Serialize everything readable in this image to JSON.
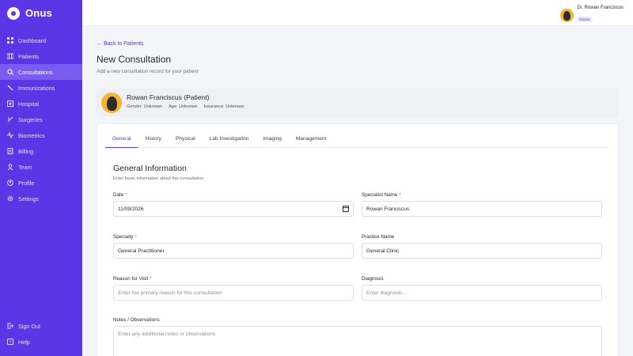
{
  "brand": {
    "name": "Onus"
  },
  "sidebar": {
    "items": [
      {
        "label": "Dashboard",
        "icon": "grid-icon",
        "active": false
      },
      {
        "label": "Patients",
        "icon": "users-icon",
        "active": false
      },
      {
        "label": "Consultations",
        "icon": "stethoscope-icon",
        "active": true
      },
      {
        "label": "Immunizations",
        "icon": "syringe-icon",
        "active": false
      },
      {
        "label": "Hospital",
        "icon": "hospital-icon",
        "active": false
      },
      {
        "label": "Surgeries",
        "icon": "scalpel-icon",
        "active": false
      },
      {
        "label": "Biometrics",
        "icon": "pulse-icon",
        "active": false
      },
      {
        "label": "Billing",
        "icon": "receipt-icon",
        "active": false
      },
      {
        "label": "Team",
        "icon": "team-icon",
        "active": false
      },
      {
        "label": "Profile",
        "icon": "user-icon",
        "active": false
      },
      {
        "label": "Settings",
        "icon": "gear-icon",
        "active": false
      }
    ],
    "bottom": [
      {
        "label": "Sign Out",
        "icon": "sign-out-icon"
      },
      {
        "label": "Help",
        "icon": "help-icon"
      }
    ]
  },
  "user": {
    "name": "Dr. Rowan Franciscus",
    "role": "Doctor"
  },
  "page": {
    "back_label": "← Back to Patients",
    "title": "New Consultation",
    "subtitle": "Add a new consultation record for your patient"
  },
  "patient": {
    "name": "Rowan Franciscus (Patient)",
    "gender": "Gender: Unknown",
    "age": "Age: Unknown",
    "insurance": "Insurance: Unknown"
  },
  "tabs": [
    "General",
    "History",
    "Physical",
    "Lab Investigation",
    "Imaging",
    "Management"
  ],
  "section": {
    "title": "General Information",
    "subtitle": "Enter basic information about this consultation"
  },
  "form": {
    "date": {
      "label": "Date",
      "value": "11/09/2026"
    },
    "specialist": {
      "label": "Specialist Name",
      "value": "Rowan Franciscus"
    },
    "specialty": {
      "label": "Specialty",
      "value": "General Practitioner"
    },
    "practice": {
      "label": "Practice Name",
      "value": "General Clinic"
    },
    "reason": {
      "label": "Reason for Visit",
      "placeholder": "Enter the primary reason for this consultation"
    },
    "diagnosis": {
      "label": "Diagnosis",
      "placeholder": "Enter diagnosis..."
    },
    "notes": {
      "label": "Notes / Observations",
      "placeholder": "Enter any additional notes or observations"
    },
    "required_mark": "*"
  },
  "colors": {
    "accent": "#5b35e6",
    "sidebar_bg": "#5b35e6",
    "active_item": "#7a5cf0"
  }
}
